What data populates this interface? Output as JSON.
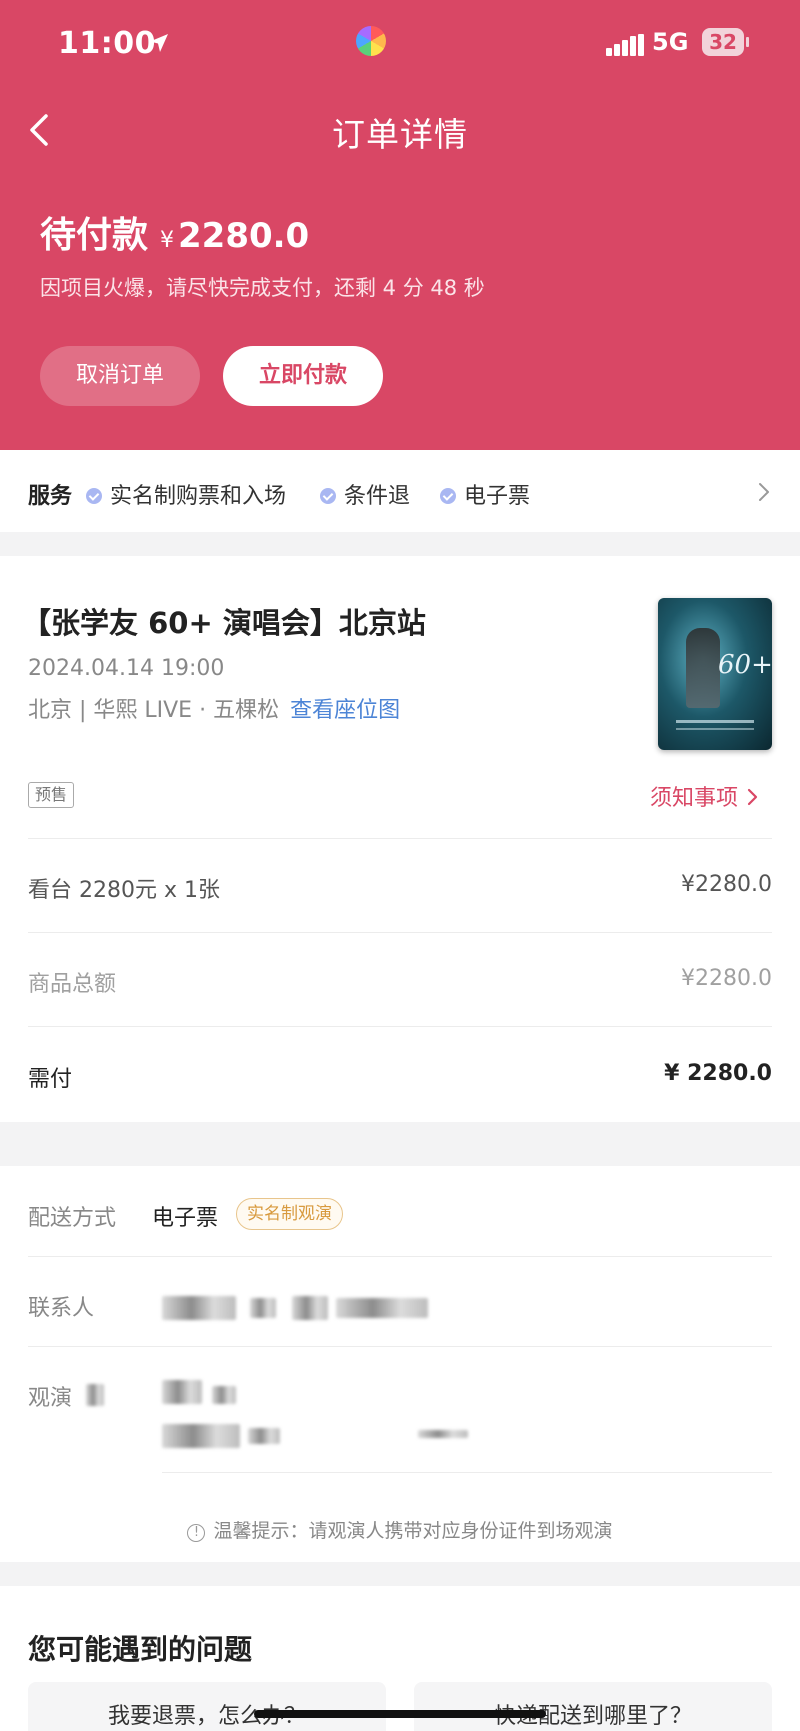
{
  "status_bar": {
    "time": "11:00",
    "network": "5G",
    "battery": "32",
    "location_icon": "location-arrow-icon",
    "signal_icon": "cellular-signal-icon"
  },
  "nav": {
    "title": "订单详情",
    "back_icon": "chevron-left-icon"
  },
  "order_status": {
    "label": "待付款",
    "currency": "¥",
    "amount": "2280.0",
    "urge_text": "因项目火爆，请尽快完成支付，还剩 4 分 48 秒",
    "cancel_label": "取消订单",
    "pay_label": "立即付款"
  },
  "services": {
    "title": "服务",
    "items": [
      "实名制购票和入场",
      "条件退",
      "电子票"
    ]
  },
  "event": {
    "title": "【张学友 60+ 演唱会】北京站",
    "datetime": "2024.04.14 19:00",
    "venue": "北京 | 华熙 LIVE · 五棵松",
    "seat_map_link": "查看座位图",
    "tag": "预售",
    "notice_link": "须知事项",
    "poster_text": "60+"
  },
  "price": {
    "ticket_label": "看台 2280元 x 1张",
    "ticket_value": "¥2280.0",
    "subtotal_label": "商品总额",
    "subtotal_value": "¥2280.0",
    "total_label": "需付",
    "total_value": "¥ 2280.0"
  },
  "delivery": {
    "method_label": "配送方式",
    "method_value": "电子票",
    "method_badge": "实名制观演",
    "contact_label": "联系人",
    "attendee_label": "观演",
    "tip": "温馨提示：请观演人携带对应身份证件到场观演"
  },
  "faq": {
    "title": "您可能遇到的问题",
    "items": [
      "我要退票，怎么办？",
      "快递配送到哪里了？"
    ]
  },
  "colors": {
    "brand": "#d94765",
    "link": "#4c84d6",
    "badge": "#d89a3e"
  }
}
